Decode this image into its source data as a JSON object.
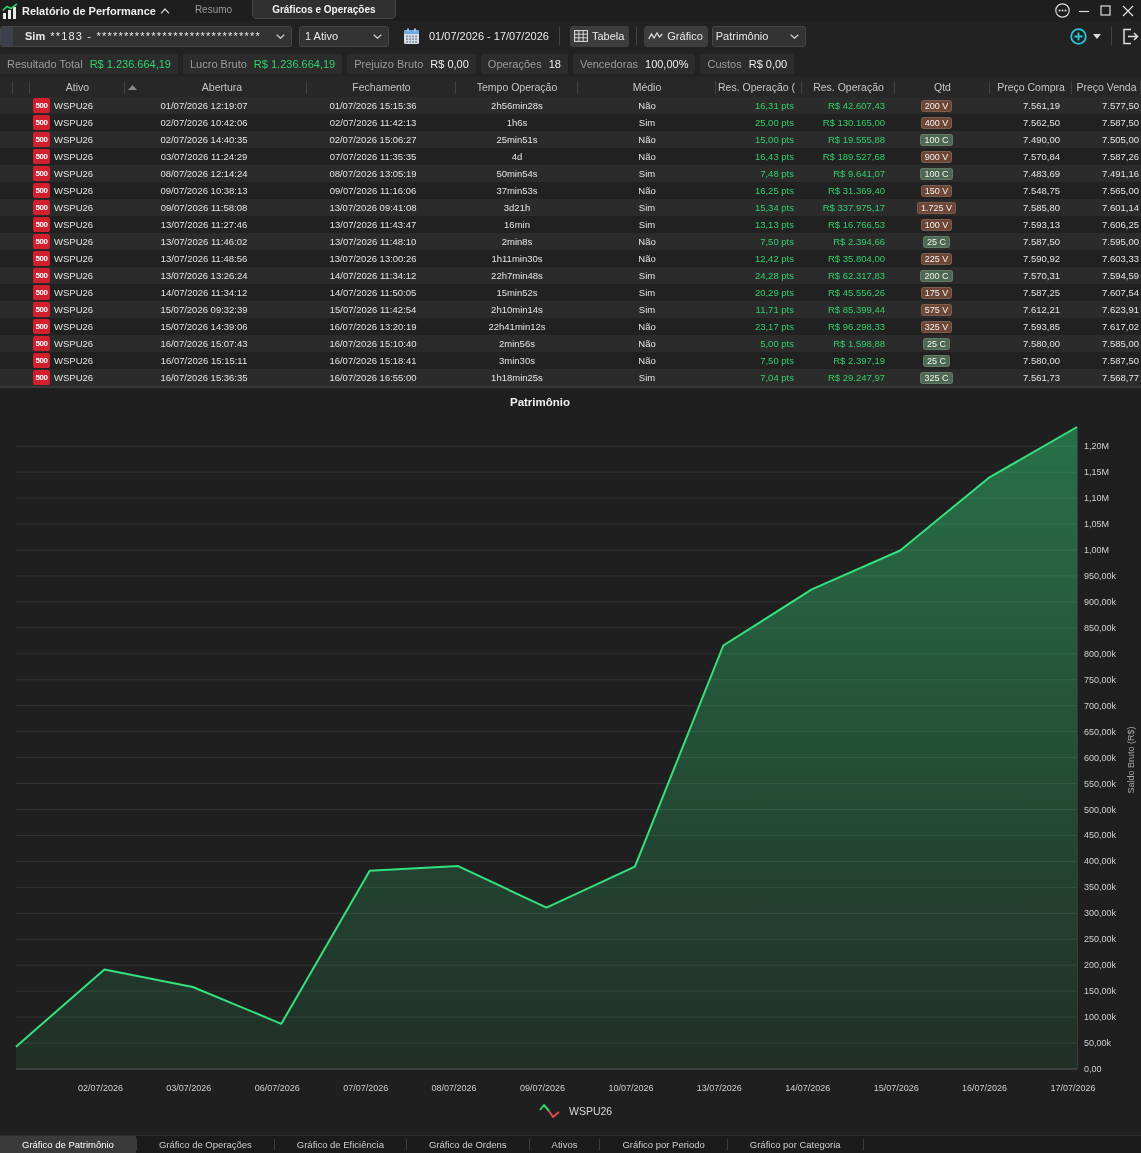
{
  "window": {
    "title": "Relatório de Performance",
    "tabs": [
      {
        "label": "Resumo",
        "selected": false
      },
      {
        "label": "Gráficos e Operações",
        "selected": true
      }
    ]
  },
  "toolbar": {
    "account": {
      "label": "Sim",
      "value": "**183 - ******************************"
    },
    "asset_filter": "1 Ativo",
    "date_range": "01/07/2026 - 17/07/2026",
    "view_toggles": [
      {
        "label": "Tabela",
        "on": true
      },
      {
        "label": "Gráfico",
        "on": true
      }
    ],
    "chart_select": "Patrimônio"
  },
  "stats": [
    {
      "label": "Resultado Total",
      "value": "R$ 1.236.664,19",
      "positive": true
    },
    {
      "label": "Lucro Bruto",
      "value": "R$ 1.236.664,19",
      "positive": true
    },
    {
      "label": "Prejuizo Bruto",
      "value": "R$ 0,00",
      "positive": false
    },
    {
      "label": "Operações",
      "value": "18",
      "positive": false
    },
    {
      "label": "Vencedoras",
      "value": "100,00%",
      "positive": false
    },
    {
      "label": "Custos",
      "value": "R$ 0,00",
      "positive": false
    }
  ],
  "table": {
    "columns": [
      {
        "label": "Ativo",
        "sorted": false
      },
      {
        "label": "Abertura",
        "sorted": true
      },
      {
        "label": "Fechamento",
        "sorted": false
      },
      {
        "label": "Tempo Operação",
        "sorted": false
      },
      {
        "label": "Médio",
        "sorted": false
      },
      {
        "label": "Res. Operação (",
        "sorted": false
      },
      {
        "label": "Res. Operação",
        "sorted": false
      },
      {
        "label": "Qtd",
        "sorted": false
      },
      {
        "label": "Preço Compra",
        "sorted": false
      },
      {
        "label": "Preço Venda",
        "sorted": false
      }
    ],
    "rows": [
      {
        "badge": "500",
        "asset": "WSPU26",
        "open": "01/07/2026 12:19:07",
        "close": "01/07/2026 15:15:36",
        "duration": "2h56min28s",
        "average": "Não",
        "result_pts": "16,31 pts",
        "result_brl": "R$ 42.607,43",
        "qty": {
          "label": "200 V",
          "color": "#6d4636"
        },
        "buy": "7.561,19",
        "sell": "7.577,50"
      },
      {
        "badge": "500",
        "asset": "WSPU26",
        "open": "02/07/2026 10:42:06",
        "close": "02/07/2026 11:42:13",
        "duration": "1h6s",
        "average": "Sim",
        "result_pts": "25,00 pts",
        "result_brl": "R$ 130.165,00",
        "qty": {
          "label": "400 V",
          "color": "#6d4636"
        },
        "buy": "7.562,50",
        "sell": "7.587,50"
      },
      {
        "badge": "500",
        "asset": "WSPU26",
        "open": "02/07/2026 14:40:35",
        "close": "02/07/2026 15:06:27",
        "duration": "25min51s",
        "average": "Não",
        "result_pts": "15,00 pts",
        "result_brl": "R$ 19.555,88",
        "qty": {
          "label": "100 C",
          "color": "#4d6953"
        },
        "buy": "7.490,00",
        "sell": "7.505,00"
      },
      {
        "badge": "500",
        "asset": "WSPU26",
        "open": "03/07/2026 11:24:29",
        "close": "07/07/2026 11:35:35",
        "duration": "4d",
        "average": "Não",
        "result_pts": "16,43 pts",
        "result_brl": "R$ 189.527,68",
        "qty": {
          "label": "900 V",
          "color": "#6d4636"
        },
        "buy": "7.570,84",
        "sell": "7.587,26"
      },
      {
        "badge": "500",
        "asset": "WSPU26",
        "open": "08/07/2026 12:14:24",
        "close": "08/07/2026 13:05:19",
        "duration": "50min54s",
        "average": "Sim",
        "result_pts": "7,48 pts",
        "result_brl": "R$ 9.641,07",
        "qty": {
          "label": "100 C",
          "color": "#4d6953"
        },
        "buy": "7.483,69",
        "sell": "7.491,16"
      },
      {
        "badge": "500",
        "asset": "WSPU26",
        "open": "09/07/2026 10:38:13",
        "close": "09/07/2026 11:16:06",
        "duration": "37min53s",
        "average": "Não",
        "result_pts": "16,25 pts",
        "result_brl": "R$ 31.369,40",
        "qty": {
          "label": "150 V",
          "color": "#6d4636"
        },
        "buy": "7.548,75",
        "sell": "7.565,00"
      },
      {
        "badge": "500",
        "asset": "WSPU26",
        "open": "09/07/2026 11:58:08",
        "close": "13/07/2026 09:41:08",
        "duration": "3d21h",
        "average": "Sim",
        "result_pts": "15,34 pts",
        "result_brl": "R$ 337.975,17",
        "qty": {
          "label": "1.725 V",
          "color": "#6d4636"
        },
        "buy": "7.585,80",
        "sell": "7.601,14"
      },
      {
        "badge": "500",
        "asset": "WSPU26",
        "open": "13/07/2026 11:27:46",
        "close": "13/07/2026 11:43:47",
        "duration": "16min",
        "average": "Sim",
        "result_pts": "13,13 pts",
        "result_brl": "R$ 16.766,53",
        "qty": {
          "label": "100 V",
          "color": "#6d4636"
        },
        "buy": "7.593,13",
        "sell": "7.606,25"
      },
      {
        "badge": "500",
        "asset": "WSPU26",
        "open": "13/07/2026 11:46:02",
        "close": "13/07/2026 11:48:10",
        "duration": "2min8s",
        "average": "Não",
        "result_pts": "7,50 pts",
        "result_brl": "R$ 2.394,66",
        "qty": {
          "label": "25 C",
          "color": "#4d6953"
        },
        "buy": "7.587,50",
        "sell": "7.595,00"
      },
      {
        "badge": "500",
        "asset": "WSPU26",
        "open": "13/07/2026 11:48:56",
        "close": "13/07/2026 13:00:26",
        "duration": "1h11min30s",
        "average": "Não",
        "result_pts": "12,42 pts",
        "result_brl": "R$ 35.804,00",
        "qty": {
          "label": "225 V",
          "color": "#6d4636"
        },
        "buy": "7.590,92",
        "sell": "7.603,33"
      },
      {
        "badge": "500",
        "asset": "WSPU26",
        "open": "13/07/2026 13:26:24",
        "close": "14/07/2026 11:34:12",
        "duration": "22h7min48s",
        "average": "Sim",
        "result_pts": "24,28 pts",
        "result_brl": "R$ 62.317,83",
        "qty": {
          "label": "200 C",
          "color": "#4d6953"
        },
        "buy": "7.570,31",
        "sell": "7.594,59"
      },
      {
        "badge": "500",
        "asset": "WSPU26",
        "open": "14/07/2026 11:34:12",
        "close": "14/07/2026 11:50:05",
        "duration": "15min52s",
        "average": "Sim",
        "result_pts": "20,29 pts",
        "result_brl": "R$ 45.556,26",
        "qty": {
          "label": "175 V",
          "color": "#6d4636"
        },
        "buy": "7.587,25",
        "sell": "7.607,54"
      },
      {
        "badge": "500",
        "asset": "WSPU26",
        "open": "15/07/2026 09:32:39",
        "close": "15/07/2026 11:42:54",
        "duration": "2h10min14s",
        "average": "Sim",
        "result_pts": "11,71 pts",
        "result_brl": "R$ 85.399,44",
        "qty": {
          "label": "575 V",
          "color": "#6d4636"
        },
        "buy": "7.612,21",
        "sell": "7.623,91"
      },
      {
        "badge": "500",
        "asset": "WSPU26",
        "open": "15/07/2026 14:39:06",
        "close": "16/07/2026 13:20:19",
        "duration": "22h41min12s",
        "average": "Não",
        "result_pts": "23,17 pts",
        "result_brl": "R$ 96.298,33",
        "qty": {
          "label": "325 V",
          "color": "#6d4636"
        },
        "buy": "7.593,85",
        "sell": "7.617,02"
      },
      {
        "badge": "500",
        "asset": "WSPU26",
        "open": "16/07/2026 15:07:43",
        "close": "16/07/2026 15:10:40",
        "duration": "2min56s",
        "average": "Não",
        "result_pts": "5,00 pts",
        "result_brl": "R$ 1.598,88",
        "qty": {
          "label": "25 C",
          "color": "#4d6953"
        },
        "buy": "7.580,00",
        "sell": "7.585,00"
      },
      {
        "badge": "500",
        "asset": "WSPU26",
        "open": "16/07/2026 15:15:11",
        "close": "16/07/2026 15:18:41",
        "duration": "3min30s",
        "average": "Não",
        "result_pts": "7,50 pts",
        "result_brl": "R$ 2.397,19",
        "qty": {
          "label": "25 C",
          "color": "#4d6953"
        },
        "buy": "7.580,00",
        "sell": "7.587,50"
      },
      {
        "badge": "500",
        "asset": "WSPU26",
        "open": "16/07/2026 15:36:35",
        "close": "16/07/2026 16:55:00",
        "duration": "1h18min25s",
        "average": "Sim",
        "result_pts": "7,04 pts",
        "result_brl": "R$ 29.247,97",
        "qty": {
          "label": "325 C",
          "color": "#4d6953"
        },
        "buy": "7.561,73",
        "sell": "7.568,77"
      }
    ]
  },
  "chart": {
    "chart_data": {
      "type": "area",
      "title": "Patrimônio",
      "ylabel": "Saldo Bruto (R$)",
      "grid": true,
      "categories": [
        null,
        "02/07/2026",
        "03/07/2026",
        "06/07/2026",
        "07/07/2026",
        "08/07/2026",
        "09/07/2026",
        "10/07/2026",
        "13/07/2026",
        "14/07/2026",
        "15/07/2026",
        "16/07/2026",
        "17/07/2026"
      ],
      "ylim": [
        0,
        1237000
      ],
      "yticks": [
        {
          "value": 0,
          "label": "0,00"
        },
        {
          "value": 50000,
          "label": "50,00k"
        },
        {
          "value": 100000,
          "label": "100,00k"
        },
        {
          "value": 150000,
          "label": "150,00k"
        },
        {
          "value": 200000,
          "label": "200,00k"
        },
        {
          "value": 250000,
          "label": "250,00k"
        },
        {
          "value": 300000,
          "label": "300,00k"
        },
        {
          "value": 350000,
          "label": "350,00k"
        },
        {
          "value": 400000,
          "label": "400,00k"
        },
        {
          "value": 450000,
          "label": "450,00k"
        },
        {
          "value": 500000,
          "label": "500,00k"
        },
        {
          "value": 550000,
          "label": "550,00k"
        },
        {
          "value": 600000,
          "label": "600,00k"
        },
        {
          "value": 650000,
          "label": "650,00k"
        },
        {
          "value": 700000,
          "label": "700,00k"
        },
        {
          "value": 750000,
          "label": "750,00k"
        },
        {
          "value": 800000,
          "label": "800,00k"
        },
        {
          "value": 850000,
          "label": "850,00k"
        },
        {
          "value": 900000,
          "label": "900,00k"
        },
        {
          "value": 950000,
          "label": "950,00k"
        },
        {
          "value": 1000000,
          "label": "1,00M"
        },
        {
          "value": 1050000,
          "label": "1,05M"
        },
        {
          "value": 1100000,
          "label": "1,10M"
        },
        {
          "value": 1150000,
          "label": "1,15M"
        },
        {
          "value": 1200000,
          "label": "1,20M"
        }
      ],
      "series": [
        {
          "name": "WSPU26",
          "color": "#35e07f",
          "values": [
            43000,
            192000,
            158000,
            87000,
            382000,
            391000,
            311000,
            390000,
            816000,
            924000,
            999000,
            1139000,
            1237000
          ]
        }
      ]
    }
  },
  "chart_tabs": [
    {
      "label": "Gráfico de Patrimônio",
      "selected": true
    },
    {
      "label": "Gráfico de Operações",
      "selected": false
    },
    {
      "label": "Gráfico de Eficiência",
      "selected": false
    },
    {
      "label": "Gráfico de Ordens",
      "selected": false
    },
    {
      "label": "Ativos",
      "selected": false
    },
    {
      "label": "Gráfico por Periodo",
      "selected": false
    },
    {
      "label": "Gráfico por Categoria",
      "selected": false
    }
  ]
}
